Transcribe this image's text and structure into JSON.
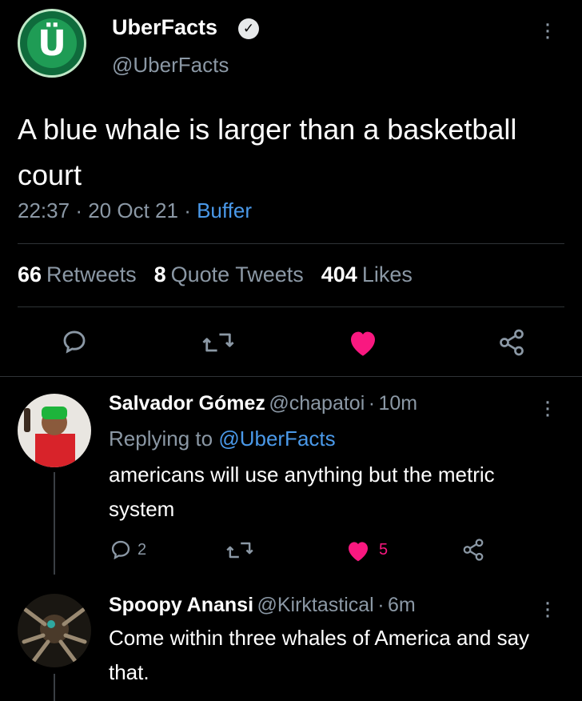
{
  "tweet": {
    "avatar_letter": "Ü",
    "author_name": "UberFacts",
    "verified_glyph": "✓",
    "handle": "@UberFacts",
    "text": "A blue whale is larger than a basketball court",
    "time": "22:37",
    "separator": "·",
    "date": "20 Oct 21",
    "source": "Buffer",
    "retweets_count": "66",
    "retweets_label": "Retweets",
    "quotes_count": "8",
    "quotes_label": "Quote Tweets",
    "likes_count": "404",
    "likes_label": "Likes",
    "liked": true
  },
  "replies": [
    {
      "author_name": "Salvador Gómez",
      "handle": "@chapatoi",
      "separator": "·",
      "age": "10m",
      "replying_prefix": "Replying to",
      "replying_to": "@UberFacts",
      "text": "americans will use anything but the metric system",
      "reply_count": "2",
      "like_count": "5",
      "liked": true
    },
    {
      "author_name": "Spoopy Anansi",
      "handle": "@Kirktastical",
      "separator": "·",
      "age": "6m",
      "text": "Come within three whales of America and say that."
    }
  ],
  "icons": {
    "reply": "reply-icon",
    "retweet": "retweet-icon",
    "like": "heart-icon",
    "share": "share-icon",
    "more": "more-icon"
  },
  "colors": {
    "background": "#000000",
    "text": "#e7e9ea",
    "muted": "#8b98a5",
    "link": "#4a99e9",
    "like": "#f91880"
  }
}
